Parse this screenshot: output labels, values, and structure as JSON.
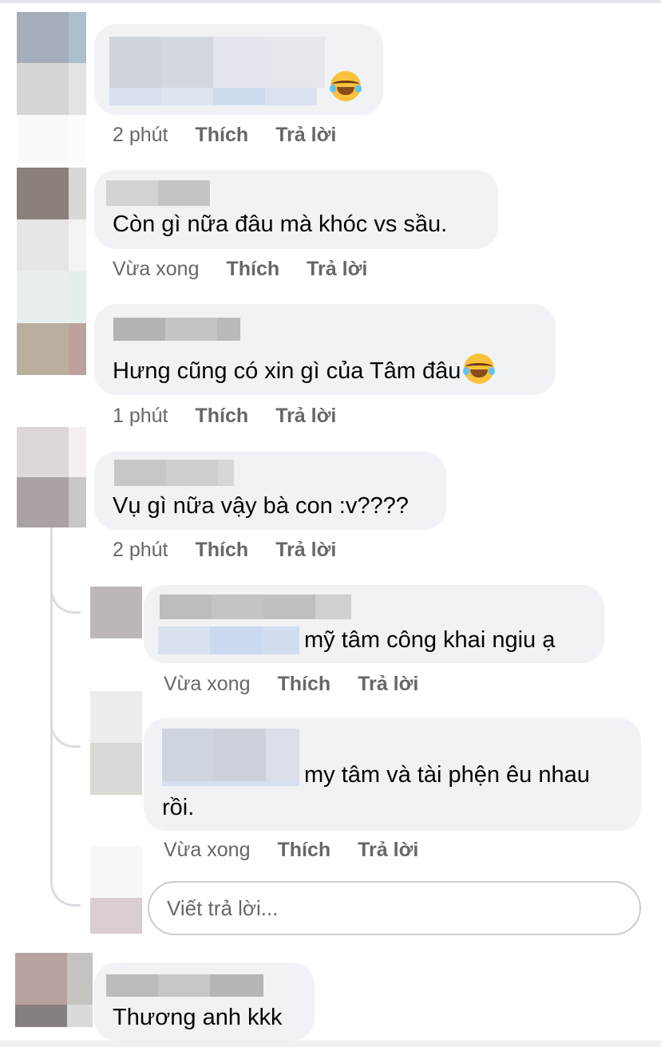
{
  "comments": [
    {
      "time": "2 phút",
      "like_label": "Thích",
      "reply_label": "Trả lời",
      "text": ""
    },
    {
      "time": "Vừa xong",
      "like_label": "Thích",
      "reply_label": "Trả lời",
      "text": "Còn gì nữa đâu mà khóc vs sầu."
    },
    {
      "time": "1 phút",
      "like_label": "Thích",
      "reply_label": "Trả lời",
      "text": "Hưng cũng có xin gì của Tâm đâu"
    },
    {
      "time": "2 phút",
      "like_label": "Thích",
      "reply_label": "Trả lời",
      "text": "Vụ gì nữa vậy bà con :v????",
      "replies": [
        {
          "time": "Vừa xong",
          "like_label": "Thích",
          "reply_label": "Trả lời",
          "text": "mỹ tâm công khai ngiu ạ"
        },
        {
          "time": "Vừa xong",
          "like_label": "Thích",
          "reply_label": "Trả lời",
          "text_line1": "my tâm và tài phện êu nhau",
          "text_line2": "rồi."
        }
      ],
      "reply_input_placeholder": "Viết trả lời..."
    },
    {
      "text": "Thương anh kkk"
    }
  ],
  "icons": {
    "laugh_emoji": "face-with-tears-of-joy-icon"
  },
  "colors": {
    "bubble": "#f0f2f5",
    "meta_text": "#65676b",
    "thread_line": "#dadde1"
  }
}
